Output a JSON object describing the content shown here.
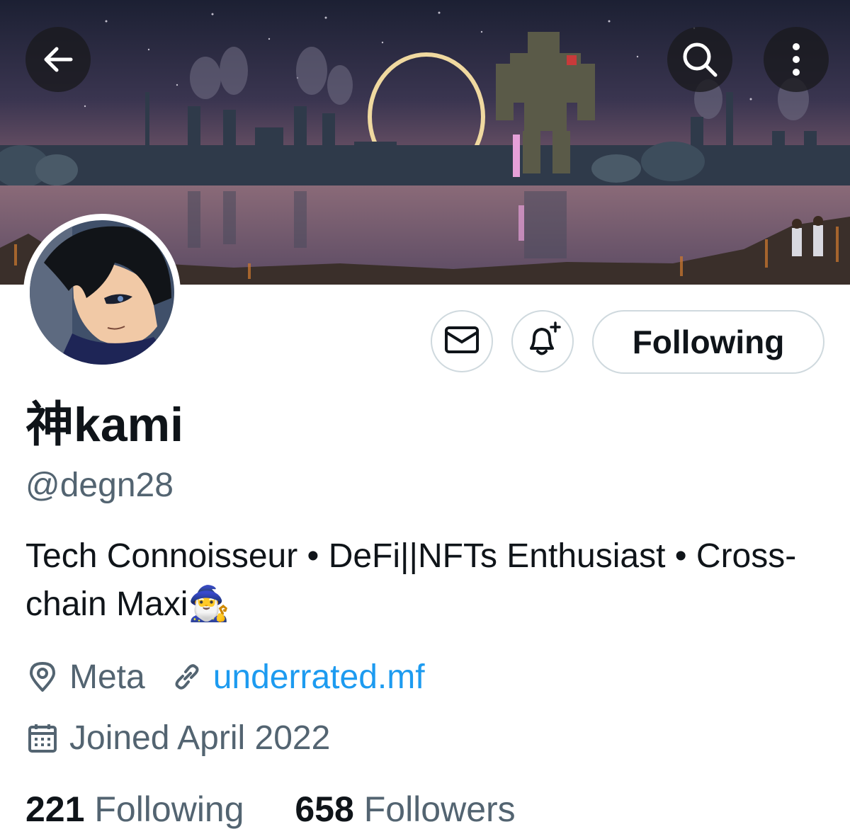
{
  "header": {
    "back_icon": "arrow-left-icon",
    "search_icon": "search-icon",
    "more_icon": "more-vertical-icon"
  },
  "banner": {
    "description": "pixel-art-city-mecha-banner"
  },
  "avatar": {
    "description": "anime-character-avatar"
  },
  "actions": {
    "message_icon": "envelope-icon",
    "notify_icon": "bell-plus-icon",
    "following_label": "Following"
  },
  "profile": {
    "display_name": "神kami",
    "handle": "@degn28",
    "bio": "Tech Connoisseur • DeFi||NFTs Enthusiast • Cross-chain Maxi🧙‍♂️",
    "location": "Meta",
    "website": "underrated.mf",
    "joined": "Joined April 2022"
  },
  "stats": {
    "following_count": "221",
    "following_label": "Following",
    "followers_count": "658",
    "followers_label": "Followers"
  },
  "colors": {
    "accent": "#1d9bf0",
    "text": "#0f1419",
    "secondary": "#536471",
    "border": "#cfd9de"
  }
}
